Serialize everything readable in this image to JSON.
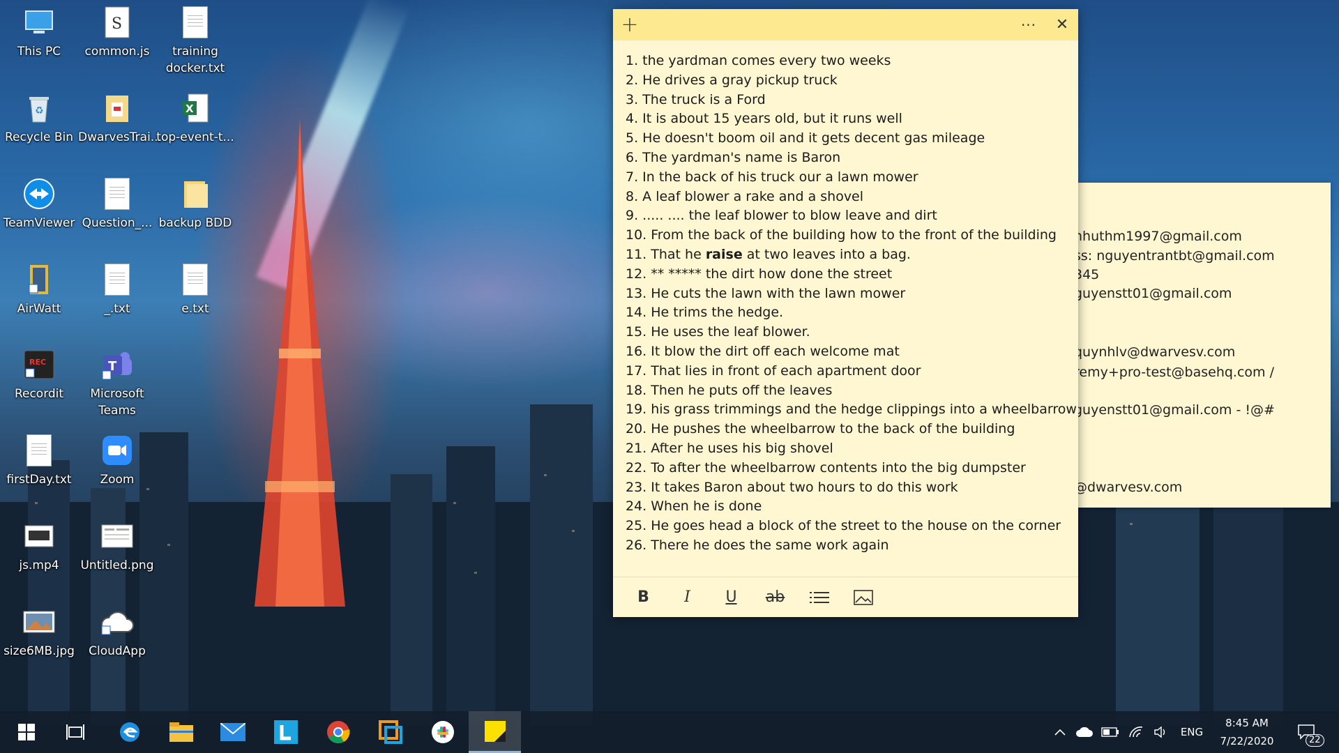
{
  "desktop_icons": [
    {
      "label": "This PC",
      "icon": "pc-icon"
    },
    {
      "label": "common.js",
      "icon": "js-file-icon"
    },
    {
      "label": "training docker.txt",
      "icon": "text-file-icon"
    },
    {
      "label": "Recycle Bin",
      "icon": "recycle-bin-icon"
    },
    {
      "label": "DwarvesTrai...",
      "icon": "pdf-folder-icon"
    },
    {
      "label": "top-event-t...",
      "icon": "excel-file-icon"
    },
    {
      "label": "TeamViewer",
      "icon": "teamviewer-icon"
    },
    {
      "label": "Question_...",
      "icon": "text-file-icon"
    },
    {
      "label": "backup BDD",
      "icon": "folder-icon"
    },
    {
      "label": "AirWatt",
      "icon": "airwatt-icon"
    },
    {
      "label": "_.txt",
      "icon": "text-file-icon"
    },
    {
      "label": "e.txt",
      "icon": "text-file-icon"
    },
    {
      "label": "Recordit",
      "icon": "recordit-icon"
    },
    {
      "label": "Microsoft Teams",
      "icon": "teams-icon"
    },
    {
      "label": "firstDay.txt",
      "icon": "text-file-icon"
    },
    {
      "label": "Zoom",
      "icon": "zoom-icon"
    },
    {
      "label": "js.mp4",
      "icon": "video-file-icon"
    },
    {
      "label": "Untitled.png",
      "icon": "image-file-icon"
    },
    {
      "label": "size6MB.jpg",
      "icon": "photo-file-icon"
    },
    {
      "label": "CloudApp",
      "icon": "cloudapp-icon"
    }
  ],
  "sticky_note": {
    "lines": [
      "1. the yardman comes every two weeks",
      "2. He drives a gray pickup truck",
      "3. The truck is a Ford",
      "4. It is about 15 years old, but it runs well",
      "5. He doesn't boom oil and it gets decent gas mileage",
      "6. The yardman's name is Baron",
      "7. In the back of his truck our a lawn mower",
      "8. A leaf blower a rake and a shovel",
      "9. ..... .... the leaf blower to blow leave  and dirt",
      "10. From the back of the building how to the front of the building",
      "11. That he ",
      "12. ** ***** the dirt how done the street",
      "13. He cuts the lawn with the lawn mower",
      "14. He trims the hedge.",
      "15. He uses the leaf blower.",
      "16. It blow the dirt off each welcome mat",
      "17. That lies in front of each apartment door",
      "18.  Then he puts off the leaves",
      "19. his grass trimmings and the hedge clippings into a wheelbarrow",
      "20. He pushes the wheelbarrow to the back of the building",
      "21. After he uses his big shovel",
      "22. To after the wheelbarrow contents into the  big dumpster",
      "23. It takes Baron about two hours to do this work",
      "24. When he is done",
      "25. He goes head a block of the street to the house on the corner",
      "26. There he does the same work again"
    ],
    "line11_bold": "raise",
    "line11_rest": " at two leaves into a bag.",
    "add_glyph": "+",
    "more_glyph": "···",
    "close_glyph": "✕",
    "toolbar": {
      "bold": "B",
      "italic": "I",
      "underline": "U",
      "strike": "ab"
    }
  },
  "background_note": {
    "lines": [
      "nhuthm1997@gmail.com",
      "ss: nguyentrantbt@gmail.com",
      "345",
      "guyenstt01@gmail.com",
      "quynhlv@dwarvesv.com",
      "remy+pro-test@basehq.com /",
      "guyenstt01@gmail.com - !@#",
      "@dwarvesv.com"
    ]
  },
  "taskbar": {
    "apps": [
      "start-button",
      "task-view",
      "edge",
      "file-explorer",
      "mail",
      "l-app",
      "chrome",
      "app-orange",
      "slack",
      "sticky-notes"
    ],
    "tray": {
      "language": "ENG",
      "time": "8:45 AM",
      "date": "7/22/2020",
      "notification_count": "22"
    }
  }
}
